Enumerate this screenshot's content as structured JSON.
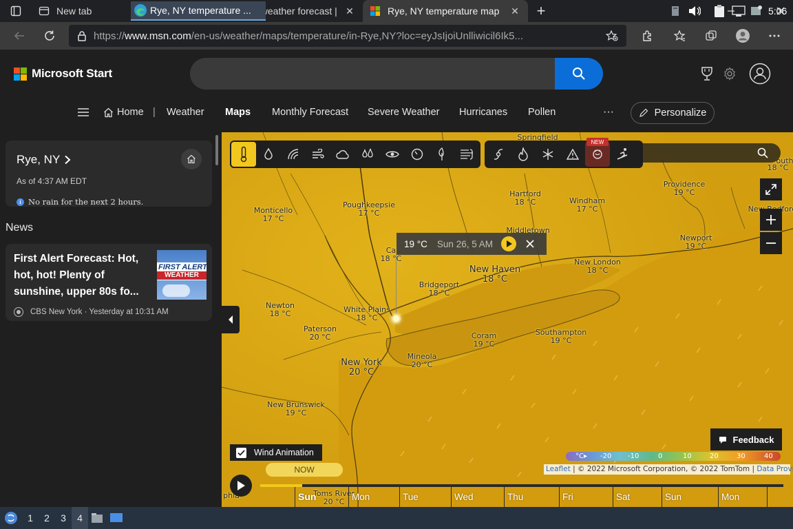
{
  "browser": {
    "tabs": [
      {
        "title": "New tab"
      },
      {
        "title": "Rye, NY weather forecast |"
      },
      {
        "title": "Rye, NY temperature map"
      }
    ],
    "url_prefix": "https://",
    "url_domain": "www.msn.com",
    "url_rest": "/en-us/weather/maps/temperature/in-Rye,NY?loc=eyJsIjoiUnlliwicil6Ik5..."
  },
  "header": {
    "brand": "Microsoft Start",
    "search_value": ""
  },
  "menu": {
    "home": "Home",
    "separator": "|",
    "weather": "Weather",
    "maps": "Maps",
    "monthly": "Monthly Forecast",
    "severe": "Severe Weather",
    "hurricanes": "Hurricanes",
    "pollen": "Pollen",
    "more": "···",
    "personalize": "Personalize"
  },
  "location": {
    "name": "Rye, NY",
    "as_of": "As of 4:37 AM EDT",
    "note": "No rain for the next 2 hours."
  },
  "news": {
    "heading": "News",
    "title": "First Alert Forecast: Hot, hot, hot! Plenty of sunshine, upper 80s fo...",
    "thumb_line1": "FIRST ALERT",
    "thumb_line2": "WEATHER",
    "source": "CBS New York · Yesterday at 10:31 AM"
  },
  "map": {
    "new_badge": "NEW",
    "popup": {
      "temp": "19 °C",
      "date": "Sun 26, 5 AM"
    },
    "cities": [
      {
        "name": "Springfield",
        "temp": ""
      },
      {
        "name": "",
        "temp": "17 °C"
      },
      {
        "name": "Poughkeepsie",
        "temp": "17 °C"
      },
      {
        "name": "Monticello",
        "temp": "17 °C"
      },
      {
        "name": "Hartford",
        "temp": "18 °C"
      },
      {
        "name": "Windham",
        "temp": "17 °C"
      },
      {
        "name": "Providence",
        "temp": "19 °C"
      },
      {
        "name": "",
        "temp": "18 °C"
      },
      {
        "name": "New Bedford",
        "temp": ""
      },
      {
        "name": "Middletown",
        "temp": ""
      },
      {
        "name": "Newport",
        "temp": "19 °C"
      },
      {
        "name": "Ca",
        "temp": "18 °C"
      },
      {
        "name": "New Haven",
        "temp": "18 °C"
      },
      {
        "name": "New London",
        "temp": "18 °C"
      },
      {
        "name": "Bridgeport",
        "temp": "18 °C"
      },
      {
        "name": "Newton",
        "temp": "18 °C"
      },
      {
        "name": "White Plains",
        "temp": "18 °C"
      },
      {
        "name": "Paterson",
        "temp": "20 °C"
      },
      {
        "name": "Coram",
        "temp": "19 °C"
      },
      {
        "name": "Southampton",
        "temp": "19 °C"
      },
      {
        "name": "Mineola",
        "temp": "20 °C"
      },
      {
        "name": "New York",
        "temp": "20 °C"
      },
      {
        "name": "New Brunswick",
        "temp": "19 °C"
      },
      {
        "name": "Toms River",
        "temp": "20 °C"
      },
      {
        "name": "phia",
        "temp": ""
      },
      {
        "name": "outh",
        "temp": ""
      }
    ],
    "feedback": "Feedback",
    "legend": {
      "unit": "°C",
      "ticks": [
        "-20",
        "-10",
        "0",
        "10",
        "20",
        "30",
        "40"
      ]
    },
    "attribution": {
      "leaflet": "Leaflet",
      "text": " | © 2022 Microsoft Corporation, © 2022 TomTom | ",
      "providers": "Data Providers"
    },
    "wind_animation": "Wind Animation",
    "now": "NOW",
    "days": [
      "Sun",
      "Mon",
      "Tue",
      "Wed",
      "Thu",
      "Fri",
      "Sat",
      "Sun",
      "Mon"
    ],
    "timeline_progress": 0.08
  },
  "taskbar": {
    "workspaces": [
      "1",
      "2",
      "3",
      "4"
    ],
    "active_task": "Rye, NY temperature ...",
    "clock": "5:06"
  },
  "colors": {
    "map_base": "#d8a611",
    "accent_yellow": "#f2c81e",
    "search_blue": "#0b6ed8"
  }
}
